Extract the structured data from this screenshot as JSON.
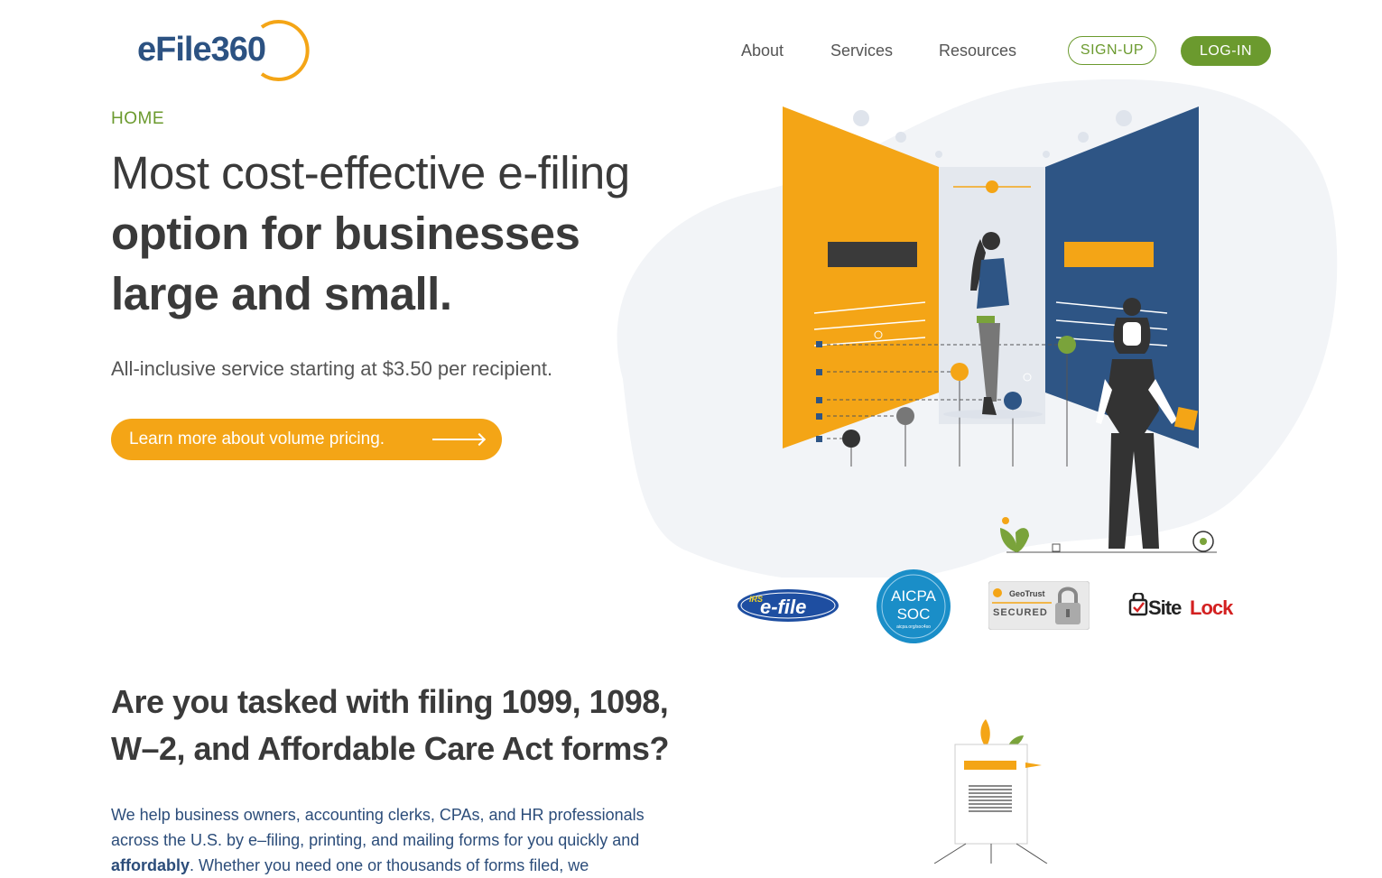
{
  "header": {
    "logo_text": "eFile360",
    "nav": [
      "About",
      "Services",
      "Resources"
    ],
    "signup_label": "SIGN-UP",
    "login_label": "LOG-IN"
  },
  "hero": {
    "breadcrumb": "HOME",
    "title_line1": "Most cost-effective e-filing",
    "title_line2": "option for businesses",
    "title_line3": "large and small.",
    "subtitle": "All-inclusive service starting at $3.50 per recipient.",
    "cta_label": "Learn more about volume pricing."
  },
  "badges": {
    "irs_small": "IRS",
    "irs": "e-file",
    "aicpa_line1": "AICPA",
    "aicpa_line2": "SOC",
    "aicpa_url": "aicpa.org/soc4so",
    "geotrust_brand": "GeoTrust",
    "geotrust": "SECURED",
    "sitelock_site": "Site",
    "sitelock_lock": "Lock"
  },
  "section2": {
    "heading_line1": "Are you tasked with filing 1099, 1098,",
    "heading_line2": "W–2, and Affordable Care Act forms?",
    "para_line1": "We help business owners, accounting clerks, CPAs, and HR professionals",
    "para_line2": "across the U.S. by e–filing, printing, and mailing forms for you quickly and",
    "para_line3_bold": "affordably",
    "para_line3_rest": ". Whether you need one or thousands of forms filed, we"
  },
  "colors": {
    "brand_green": "#6b9a2e",
    "brand_orange": "#f4a516",
    "brand_navy": "#2c5282"
  }
}
